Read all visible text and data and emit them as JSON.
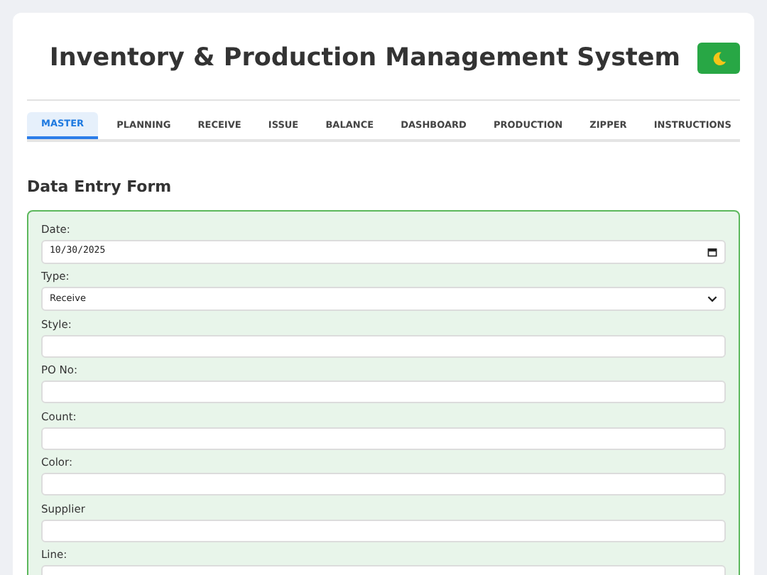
{
  "header": {
    "title": "Inventory & Production Management System"
  },
  "tabs": [
    {
      "label": "MASTER",
      "selected": true
    },
    {
      "label": "PLANNING",
      "selected": false
    },
    {
      "label": "RECEIVE",
      "selected": false
    },
    {
      "label": "ISSUE",
      "selected": false
    },
    {
      "label": "BALANCE",
      "selected": false
    },
    {
      "label": "DASHBOARD",
      "selected": false
    },
    {
      "label": "PRODUCTION",
      "selected": false
    },
    {
      "label": "ZIPPER",
      "selected": false
    },
    {
      "label": "INSTRUCTIONS",
      "selected": false
    }
  ],
  "form": {
    "title": "Data Entry Form",
    "fields": [
      {
        "kind": "date",
        "label": "Date:",
        "value": "10/30/2025"
      },
      {
        "kind": "select",
        "label": "Type:",
        "value": "Receive"
      },
      {
        "kind": "text",
        "label": "Style:"
      },
      {
        "kind": "text",
        "label": "PO No:"
      },
      {
        "kind": "text",
        "label": "Count:"
      },
      {
        "kind": "text",
        "label": "Color:"
      },
      {
        "kind": "text",
        "label": "Supplier"
      },
      {
        "kind": "text",
        "label": "Line:"
      }
    ]
  }
}
